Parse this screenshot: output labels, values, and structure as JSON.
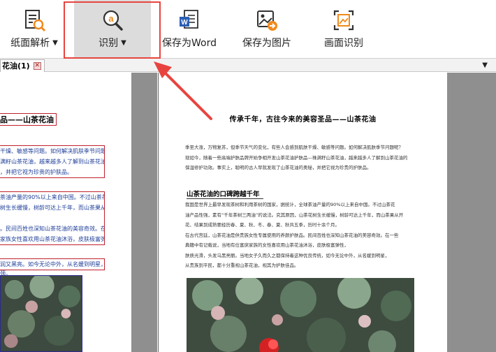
{
  "toolbar": {
    "layout_label": "纸面解析",
    "ocr_label": "识别",
    "save_word_label": "保存为Word",
    "save_image_label": "保存为图片",
    "area_ocr_label": "画面识别",
    "caret": "▼",
    "accent_color": "#e8443f"
  },
  "tab": {
    "label": "花油(1)",
    "close": "✕",
    "menu": "▼"
  },
  "left_pane": {
    "title": "品——山茶花油",
    "blocks": [
      [
        "干燥、敏感等问题。如何解决肌肤季节问题呢？",
        "满籽山茶花油，越来越多人了解到山茶花油的",
        "，并把它视为珍贵的护肤品。"
      ],
      [
        "茶油产量的90%以上来自中国。不过山茶花",
        "树生长缓慢，树龄可达上千年，而山茶果从开",
        "",
        "。民间百姓也深知山茶花油的美容奇效。在一些",
        "家族女性喜欢用山茶花油沐浴，皮肤极富弹性"
      ],
      [
        "润又黑亮。如今无论中外，从名媛到明星，"
      ]
    ],
    "tail_line": "颈。"
  },
  "right_page": {
    "title": "传承千年，古往今来的美容圣品——山茶花油",
    "intro": [
      "季至大涨，万物复苏，但季节天气的变化，有些人会感到肌肤干燥、敏感等问题。如何解决肌肤季节问题呢？",
      "现如今，随着一些高端护肤品牌开始争相开发山茶花油护肤品—珠满籽山茶花油，越来越多人了解到山茶花油的",
      "保湿修护功效。事实上，聪明的古人早就发现了山茶花油的奥秘，并把它视为珍贵的护肤品。"
    ],
    "section_title": "山茶花油的口碑跨越千年",
    "section_body": [
      "我国是世界上最早发现茶树和利用茶树的国家，据统计，全球茶油产量的90%以上来自中国。不过山茶花",
      "油产品性强，素有“千年茶树三两油”的说法。究其原因，山茶花树生长缓慢，树龄可达上千年，而山茶果从开",
      "花、结果到成熟要经历春、夏、秋、冬、春、夏、秋共五季，历时十余个月。",
      "在古代宫廷，山茶花油是供贵族女性专属使用的养颜护肤品。民间百姓也深知山茶花油的美容奇效。在一些",
      "典籍中有记载说，当地有位富庶家族的女性喜欢用山茶花油沐浴，皮肤极富弹性，",
      "肤质光滑，头发乌黑亮丽。当地女子久而久之都保持着这种优良传统，如今无论中外，从名媛到明星，",
      "从贵族到平民，都十分重视山茶花油，视其为护肤佳品。"
    ]
  }
}
